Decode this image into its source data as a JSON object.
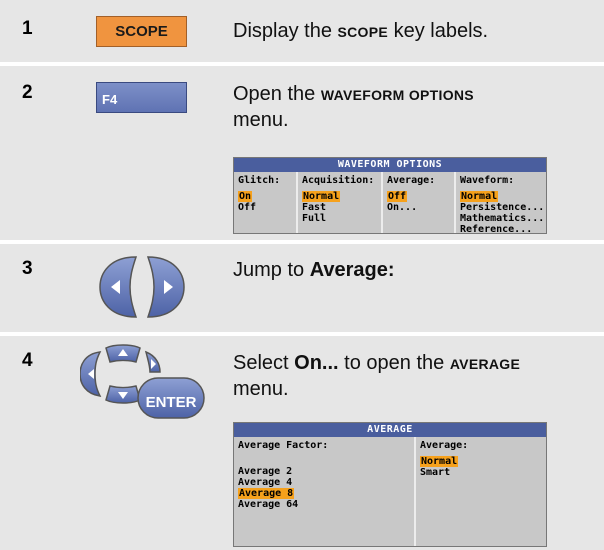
{
  "steps": [
    {
      "number": "1",
      "key_label": "SCOPE",
      "text_before": "Display the ",
      "text_sc": "SCOPE",
      "text_after": " key labels."
    },
    {
      "number": "2",
      "key_label": "F4",
      "text_line1_before": "Open the ",
      "text_line1_sc": "WAVEFORM OPTIONS",
      "text_line2": "menu."
    },
    {
      "number": "3",
      "text_before": "Jump to ",
      "text_bold": "Average:"
    },
    {
      "number": "4",
      "key_label": "ENTER",
      "text_before": "Select ",
      "text_bold": "On...",
      "text_middle": " to open the ",
      "text_sc": "AVERAGE",
      "text_line2": "menu."
    }
  ],
  "waveform_menu": {
    "title": "WAVEFORM OPTIONS",
    "glitch": {
      "header": "Glitch:",
      "items": [
        "On",
        "Off"
      ],
      "selected": "On"
    },
    "acquisition": {
      "header": "Acquisition:",
      "items": [
        "Normal",
        "Fast",
        "Full"
      ],
      "selected": "Normal"
    },
    "average": {
      "header": "Average:",
      "items": [
        "Off",
        "On..."
      ],
      "selected": "Off"
    },
    "waveform": {
      "header": "Waveform:",
      "items": [
        "Normal",
        "Persistence...",
        "Mathematics...",
        "Reference..."
      ],
      "selected": "Normal"
    }
  },
  "average_menu": {
    "title": "AVERAGE",
    "factor": {
      "header": "Average Factor:",
      "items": [
        "Average 2",
        "Average 4",
        "Average 8",
        "Average 64"
      ],
      "selected": "Average 8"
    },
    "average": {
      "header": "Average:",
      "items": [
        "Normal",
        "Smart"
      ],
      "selected": "Normal"
    }
  },
  "colors": {
    "row_bg": "#e6e6e6",
    "scope_key": "#f0943f",
    "f4_key": "#6f82bf",
    "menu_title": "#4a5e9e",
    "highlight": "#f6a11c"
  }
}
